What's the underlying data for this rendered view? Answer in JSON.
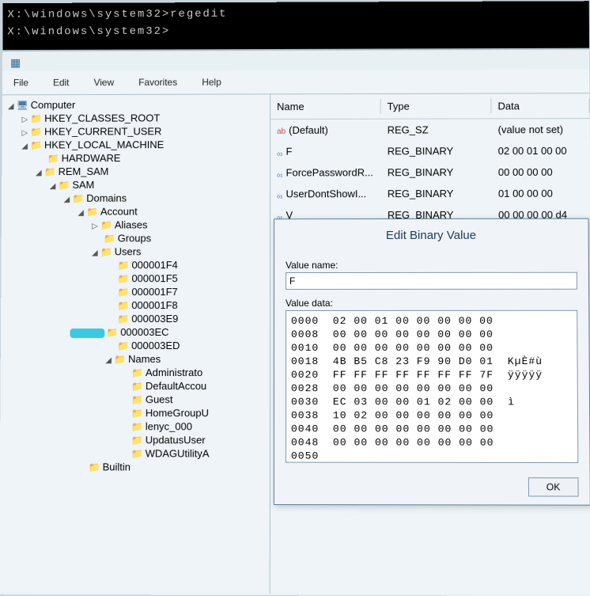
{
  "console": {
    "line1": "X:\\windows\\system32>regedit",
    "line2": "X:\\windows\\system32>"
  },
  "menu": {
    "file": "File",
    "edit": "Edit",
    "view": "View",
    "favorites": "Favorites",
    "help": "Help"
  },
  "tree": {
    "computer": "Computer",
    "hkey_classes": "HKEY_CLASSES_ROOT",
    "hkey_current": "HKEY_CURRENT_USER",
    "hkey_local": "HKEY_LOCAL_MACHINE",
    "hardware": "HARDWARE",
    "rem_sam": "REM_SAM",
    "sam": "SAM",
    "domains": "Domains",
    "account": "Account",
    "aliases": "Aliases",
    "groups": "Groups",
    "users": "Users",
    "u1": "000001F4",
    "u2": "000001F5",
    "u3": "000001F7",
    "u4": "000001F8",
    "u5": "000003E9",
    "u6": "000003EC",
    "u7": "000003ED",
    "names": "Names",
    "n1": "Administrato",
    "n2": "DefaultAccou",
    "n3": "Guest",
    "n4": "HomeGroupU",
    "n5": "lenyc_000",
    "n6": "UpdatusUser",
    "n7": "WDAGUtilityA",
    "builtin": "Builtin"
  },
  "list": {
    "head_name": "Name",
    "head_type": "Type",
    "head_data": "Data",
    "rows": [
      {
        "name": "(Default)",
        "type": "REG_SZ",
        "data": "(value not set)"
      },
      {
        "name": "F",
        "type": "REG_BINARY",
        "data": "02 00 01 00 00"
      },
      {
        "name": "ForcePasswordR...",
        "type": "REG_BINARY",
        "data": "00 00 00 00"
      },
      {
        "name": "UserDontShowI...",
        "type": "REG_BINARY",
        "data": "01 00 00 00"
      },
      {
        "name": "V",
        "type": "REG_BINARY",
        "data": "00 00 00 00 d4"
      }
    ]
  },
  "dialog": {
    "title": "Edit Binary Value",
    "value_name_label": "Value name:",
    "value_name": "F",
    "value_data_label": "Value data:",
    "hex": "0000  02 00 01 00 00 00 00 00\n0008  00 00 00 00 00 00 00 00\n0010  00 00 00 00 00 00 00 00\n0018  4B B5 C8 23 F9 90 D0 01  KµÈ#ù\n0020  FF FF FF FF FF FF FF 7F  ÿÿÿÿÿ\n0028  00 00 00 00 00 00 00 00\n0030  EC 03 00 00 01 02 00 00  ì\n0038  10 02 00 00 00 00 00 00\n0040  00 00 00 00 00 00 00 00\n0048  00 00 00 00 00 00 00 00\n0050",
    "ok": "OK"
  }
}
